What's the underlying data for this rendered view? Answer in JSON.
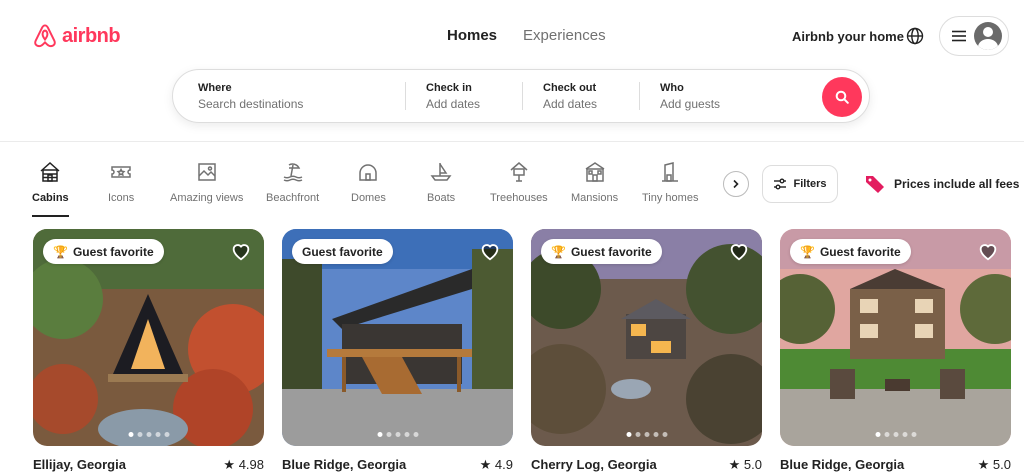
{
  "brand": {
    "name": "airbnb",
    "color": "#ff385c"
  },
  "nav": {
    "tabs": [
      "Homes",
      "Experiences"
    ],
    "active": "Homes"
  },
  "header": {
    "host_link": "Airbnb your home",
    "globe_icon": "globe-icon",
    "menu_icon": "hamburger-icon",
    "avatar_icon": "user-avatar-icon"
  },
  "search": {
    "where": {
      "label": "Where",
      "placeholder": "Search destinations"
    },
    "check_in": {
      "label": "Check in",
      "placeholder": "Add dates"
    },
    "check_out": {
      "label": "Check out",
      "placeholder": "Add dates"
    },
    "who": {
      "label": "Who",
      "placeholder": "Add guests"
    },
    "button_icon": "search-icon"
  },
  "categories": [
    {
      "label": "Cabins",
      "icon": "cabin-icon",
      "active": true
    },
    {
      "label": "Icons",
      "icon": "ticket-icon",
      "active": false
    },
    {
      "label": "Amazing views",
      "icon": "frame-icon",
      "active": false
    },
    {
      "label": "Beachfront",
      "icon": "beach-icon",
      "active": false
    },
    {
      "label": "Domes",
      "icon": "dome-icon",
      "active": false
    },
    {
      "label": "Boats",
      "icon": "boat-icon",
      "active": false
    },
    {
      "label": "Treehouses",
      "icon": "treehouse-icon",
      "active": false
    },
    {
      "label": "Mansions",
      "icon": "mansion-icon",
      "active": false
    },
    {
      "label": "Tiny homes",
      "icon": "tiny-home-icon",
      "active": false
    }
  ],
  "filters": {
    "label": "Filters",
    "icon": "sliders-icon"
  },
  "price_note": {
    "label": "Prices include all fees",
    "icon": "price-tag-icon"
  },
  "listings": [
    {
      "location": "Ellijay, Georgia",
      "rating": "4.98",
      "badge": "Guest favorite",
      "trophy": true,
      "photo_count": 5,
      "active_photo": 0
    },
    {
      "location": "Blue Ridge, Georgia",
      "rating": "4.9",
      "badge": "Guest favorite",
      "trophy": false,
      "photo_count": 5,
      "active_photo": 0
    },
    {
      "location": "Cherry Log, Georgia",
      "rating": "5.0",
      "badge": "Guest favorite",
      "trophy": true,
      "photo_count": 5,
      "active_photo": 0
    },
    {
      "location": "Blue Ridge, Georgia",
      "rating": "5.0",
      "badge": "Guest favorite",
      "trophy": true,
      "photo_count": 5,
      "active_photo": 0
    }
  ]
}
